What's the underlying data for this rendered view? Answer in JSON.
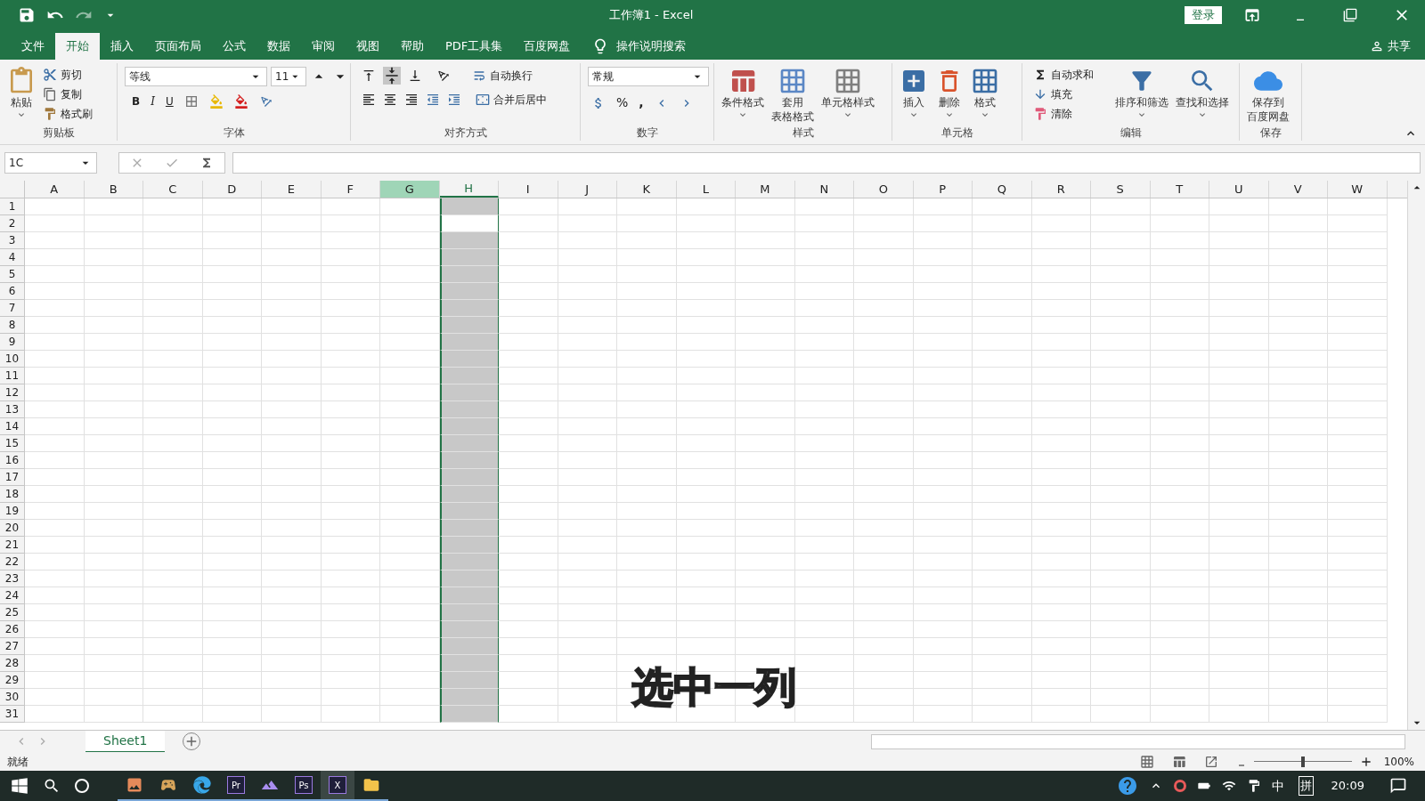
{
  "title_bar": {
    "title": "工作簿1  -  Excel",
    "login": "登录"
  },
  "menu_tabs": [
    {
      "label": "文件",
      "selected": false
    },
    {
      "label": "开始",
      "selected": true
    },
    {
      "label": "插入",
      "selected": false
    },
    {
      "label": "页面布局",
      "selected": false
    },
    {
      "label": "公式",
      "selected": false
    },
    {
      "label": "数据",
      "selected": false
    },
    {
      "label": "审阅",
      "selected": false
    },
    {
      "label": "视图",
      "selected": false
    },
    {
      "label": "帮助",
      "selected": false
    },
    {
      "label": "PDF工具集",
      "selected": false
    },
    {
      "label": "百度网盘",
      "selected": false
    }
  ],
  "tell_me": "操作说明搜索",
  "share": "共享",
  "ribbon": {
    "clipboard": {
      "paste": "粘贴",
      "cut": "剪切",
      "copy": "复制",
      "format_painter": "格式刷",
      "label": "剪贴板"
    },
    "font": {
      "name": "等线",
      "size": "11",
      "bold": "B",
      "italic": "I",
      "underline": "U",
      "label": "字体"
    },
    "alignment": {
      "wrap": "自动换行",
      "merge": "合并后居中",
      "label": "对齐方式"
    },
    "number": {
      "format": "常规",
      "percent": "%",
      "comma": ",",
      "label": "数字"
    },
    "styles": {
      "conditional": "条件格式",
      "table_1": "套用",
      "table_2": "表格格式",
      "cell_styles": "单元格样式",
      "label": "样式"
    },
    "cells": {
      "insert": "插入",
      "delete": "删除",
      "format": "格式",
      "label": "单元格"
    },
    "editing": {
      "autosum": "自动求和",
      "fill": "填充",
      "clear": "清除",
      "sort": "排序和筛选",
      "find": "查找和选择",
      "label": "编辑"
    },
    "save": {
      "line_1": "保存到",
      "line_2": "百度网盘",
      "label": "保存"
    }
  },
  "formula_bar": {
    "name_box": "1C"
  },
  "columns": [
    {
      "label": "A",
      "selected": false,
      "highlighted": false
    },
    {
      "label": "B",
      "selected": false,
      "highlighted": false
    },
    {
      "label": "C",
      "selected": false,
      "highlighted": false
    },
    {
      "label": "D",
      "selected": false,
      "highlighted": false
    },
    {
      "label": "E",
      "selected": false,
      "highlighted": false
    },
    {
      "label": "F",
      "selected": false,
      "highlighted": false
    },
    {
      "label": "G",
      "selected": false,
      "highlighted": true
    },
    {
      "label": "H",
      "selected": true,
      "highlighted": false
    },
    {
      "label": "I",
      "selected": false,
      "highlighted": false
    },
    {
      "label": "J",
      "selected": false,
      "highlighted": false
    },
    {
      "label": "K",
      "selected": false,
      "highlighted": false
    },
    {
      "label": "L",
      "selected": false,
      "highlighted": false
    },
    {
      "label": "M",
      "selected": false,
      "highlighted": false
    },
    {
      "label": "N",
      "selected": false,
      "highlighted": false
    },
    {
      "label": "O",
      "selected": false,
      "highlighted": false
    },
    {
      "label": "P",
      "selected": false,
      "highlighted": false
    },
    {
      "label": "Q",
      "selected": false,
      "highlighted": false
    },
    {
      "label": "R",
      "selected": false,
      "highlighted": false
    },
    {
      "label": "S",
      "selected": false,
      "highlighted": false
    },
    {
      "label": "T",
      "selected": false,
      "highlighted": false
    },
    {
      "label": "U",
      "selected": false,
      "highlighted": false
    },
    {
      "label": "V",
      "selected": false,
      "highlighted": false
    },
    {
      "label": "W",
      "selected": false,
      "highlighted": false
    }
  ],
  "rows": [
    {
      "label": "1",
      "active": false
    },
    {
      "label": "2",
      "active": true
    },
    {
      "label": "3",
      "active": false
    },
    {
      "label": "4",
      "active": false
    },
    {
      "label": "5",
      "active": false
    },
    {
      "label": "6",
      "active": false
    },
    {
      "label": "7",
      "active": false
    },
    {
      "label": "8",
      "active": false
    },
    {
      "label": "9",
      "active": false
    },
    {
      "label": "10",
      "active": false
    },
    {
      "label": "11",
      "active": false
    },
    {
      "label": "12",
      "active": false
    },
    {
      "label": "13",
      "active": false
    },
    {
      "label": "14",
      "active": false
    },
    {
      "label": "15",
      "active": false
    },
    {
      "label": "16",
      "active": false
    },
    {
      "label": "17",
      "active": false
    },
    {
      "label": "18",
      "active": false
    },
    {
      "label": "19",
      "active": false
    },
    {
      "label": "20",
      "active": false
    },
    {
      "label": "21",
      "active": false
    },
    {
      "label": "22",
      "active": false
    },
    {
      "label": "23",
      "active": false
    },
    {
      "label": "24",
      "active": false
    },
    {
      "label": "25",
      "active": false
    },
    {
      "label": "26",
      "active": false
    },
    {
      "label": "27",
      "active": false
    },
    {
      "label": "28",
      "active": false
    },
    {
      "label": "29",
      "active": false
    },
    {
      "label": "30",
      "active": false
    },
    {
      "label": "31",
      "active": false
    }
  ],
  "caption": "选中一列",
  "sheet_tabs": [
    {
      "label": "Sheet1",
      "selected": true
    }
  ],
  "status_bar": {
    "status": "就绪",
    "zoom": "100%",
    "zoom_slider": {
      "level": 0.5
    }
  },
  "taskbar": {
    "apps": [
      {
        "kind": "photos"
      },
      {
        "kind": "game"
      },
      {
        "kind": "edge"
      },
      {
        "kind": "letter",
        "text": "Pr",
        "active": false
      },
      {
        "kind": "mountain"
      },
      {
        "kind": "letter",
        "text": "Ps",
        "active": false
      },
      {
        "kind": "letter",
        "text": "X",
        "active": true
      },
      {
        "kind": "folder"
      }
    ],
    "ime_1": "中",
    "ime_2": "拼",
    "clock": "20:09"
  }
}
